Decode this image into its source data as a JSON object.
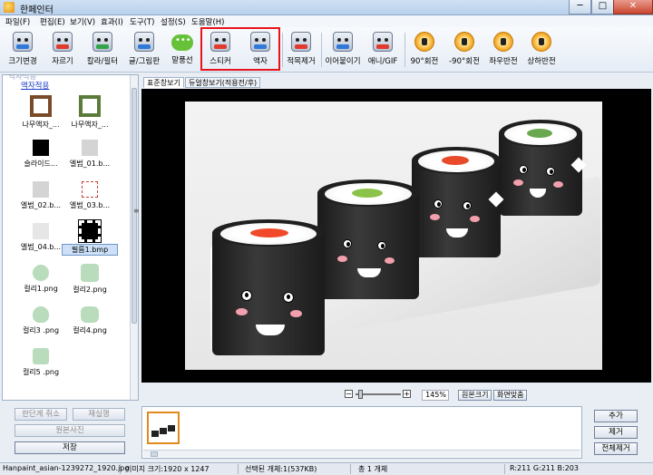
{
  "window": {
    "title": "한페인터",
    "minimize": "─",
    "maximize": "□",
    "close": "✕"
  },
  "menu": [
    "파일(F)",
    "편집(E)",
    "보기(V)",
    "효과(I)",
    "도구(T)",
    "설정(S)",
    "도움말(H)"
  ],
  "toolbar": {
    "resize": "크기변경",
    "crop": "자르기",
    "color_filter": "칼라/필터",
    "text_drawing": "글/그림판",
    "speech_bubble": "말풍선",
    "sticker": "스티커",
    "frame": "액자",
    "redeye": "적목제거",
    "join": "이어붙이기",
    "animated_gif": "애니/GIF",
    "rotate_90": "90°회전",
    "rotate_minus_90": "-90°회전",
    "flip_horizontal": "좌우반전",
    "flip_vertical": "상하반전"
  },
  "left_panel": {
    "header_faded": "액자적용",
    "header": "액자적용",
    "items": [
      {
        "label": "나무액자_..."
      },
      {
        "label": "나무액자_..."
      },
      {
        "label": "슬라이드..."
      },
      {
        "label": "엘범_01.b..."
      },
      {
        "label": "엘범_02.b..."
      },
      {
        "label": "엘범_03.b..."
      },
      {
        "label": "엘범_04.b..."
      },
      {
        "label": "필름1.bmp"
      },
      {
        "label": "컬리1.png"
      },
      {
        "label": "컬리2.png"
      },
      {
        "label": "컬리3 .png"
      },
      {
        "label": "컬리4.png"
      },
      {
        "label": "컬리5 .png"
      }
    ],
    "splitter": "≡"
  },
  "view_tabs": {
    "standard": "표준창보기",
    "dual": "듀얼창보기(적용전/후)"
  },
  "zoom": {
    "minus": "−",
    "plus": "+",
    "value": "145%",
    "original_size": "원본크기",
    "fit_screen": "화면맞춤"
  },
  "actions": {
    "undo": "한단계 취소",
    "redo": "재실행",
    "original_photo": "원본사진",
    "save": "저장"
  },
  "list_buttons": {
    "add": "추가",
    "remove": "제거",
    "remove_all": "전체제거"
  },
  "status": {
    "filename": "Hanpaint_asian-1239272_1920.jpg",
    "image_size": "이미지 크기:1920 x 1247",
    "selected": "선택된 개체:1(537KB)",
    "total": "총 1 개체",
    "rgb": "R:211 G:211 B:203"
  },
  "colors": {
    "highlight": "#e8141c",
    "link": "#1a3cc9",
    "accent": "#e08a1e"
  }
}
